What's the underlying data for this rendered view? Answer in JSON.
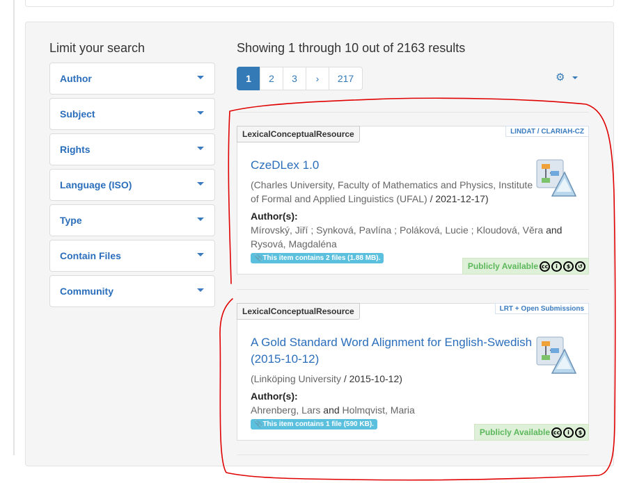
{
  "sidebar": {
    "title": "Limit your search",
    "facets": [
      {
        "label": "Author"
      },
      {
        "label": "Subject"
      },
      {
        "label": "Rights"
      },
      {
        "label": "Language (ISO)"
      },
      {
        "label": "Type"
      },
      {
        "label": "Contain Files"
      },
      {
        "label": "Community"
      }
    ]
  },
  "results": {
    "summary": "Showing 1 through 10 out of 2163 results",
    "pages": [
      "1",
      "2",
      "3",
      "›",
      "217"
    ],
    "current_page": "1",
    "settings_icon": "gear-icon"
  },
  "items": [
    {
      "type": "LexicalConceptualResource",
      "collection": "LINDAT / CLARIAH-CZ",
      "title": "CzeDLex 1.0",
      "publisher": "(Charles University, Faculty of Mathematics and Physics, Institute of Formal and Applied Linguistics (UFAL)",
      "date": " / 2021-12-17)",
      "authors_label": "Author(s):",
      "authors_list": "Mírovský, Jiří ; Synková, Pavlína ; Poláková, Lucie ; Kloudová, Věra",
      "authors_and": "and",
      "authors_last": "Rysová, Magdaléna",
      "files": "This item contains 2 files (1.88 MB).",
      "availability": "Publicly Available",
      "license_icons": [
        "cc",
        "by",
        "nc",
        "sa"
      ]
    },
    {
      "type": "LexicalConceptualResource",
      "collection": "LRT + Open Submissions",
      "title": "A Gold Standard Word Alignment for English-Swedish (2015-10-12)",
      "publisher": "(Linköping University",
      "date": " / 2015-10-12)",
      "authors_label": "Author(s):",
      "authors_list": "Ahrenberg, Lars",
      "authors_and": "and",
      "authors_last": "Holmqvist, Maria",
      "files": "This item contains 1 file (590 KB).",
      "availability": "Publicly Available",
      "license_icons": [
        "cc",
        "by",
        "nc"
      ]
    }
  ],
  "colors": {
    "link": "#2a6ebb",
    "active_page": "#337ab7",
    "available_green": "#5cb85c",
    "files_badge": "#5bc0de",
    "annotation_red": "#e00000"
  }
}
